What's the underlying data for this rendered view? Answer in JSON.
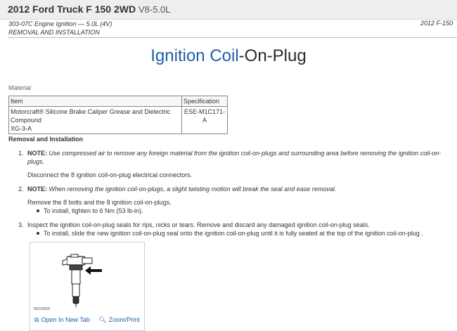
{
  "header": {
    "vehicle": "2012 Ford Truck F 150 2WD",
    "engine": "V8-5.0L"
  },
  "subheader": {
    "section": "303-07C Engine Ignition — 5.0L (4V)",
    "subsection": "REMOVAL AND INSTALLATION",
    "right_text": "2012 F-150"
  },
  "title": {
    "part1": "Ignition Coil",
    "part2": "-On-Plug"
  },
  "material": {
    "heading": "Material",
    "columns": [
      "Item",
      "Specification"
    ],
    "rows": [
      {
        "item_line1": "Motorcraft® Silicone Brake Caliper Grease and Dielectric",
        "item_line2": "Compound",
        "item_line3": "XG-3-A",
        "spec_line1": "ESE-M1C171-",
        "spec_line2": "A"
      }
    ]
  },
  "removal": {
    "heading": "Removal and Installation",
    "steps": [
      {
        "number": "1.",
        "note_label": "NOTE:",
        "note_line1": "Use compressed air to remove any foreign material from the ignition coil-on-plugs and surrounding area before removing the ignition coil-on-",
        "note_line2": "plugs.",
        "text": "Disconnect the 8 ignition coil-on-plug electrical connectors."
      },
      {
        "number": "2.",
        "note_label": "NOTE:",
        "note_line1": "When removing the ignition coil-on-plugs, a slight twisting motion will break the seal and ease removal.",
        "text": "Remove the 8 bolts and the 8 ignition coil-on-plugs.",
        "bullet": "To install, tighten to 6 Nm (53 lb-in)."
      },
      {
        "number": "3.",
        "text": "Inspect the ignition coil-on-plug seals for rips, nicks or tears. Remove and discard any damaged ignition coil-on-plug seals.",
        "bullet": "To install, slide the new ignition coil-on-plug seal onto the ignition coil-on-plug until it is fully seated at the top of the ignition coil-on-plug ."
      }
    ]
  },
  "figure": {
    "id": "N0120015",
    "open_label": "Open In New Tab",
    "zoom_label": "Zoom/Print",
    "open_icon": "external-tab-icon",
    "zoom_icon": "magnifier-icon"
  },
  "accent_color": "#1f5fa8"
}
